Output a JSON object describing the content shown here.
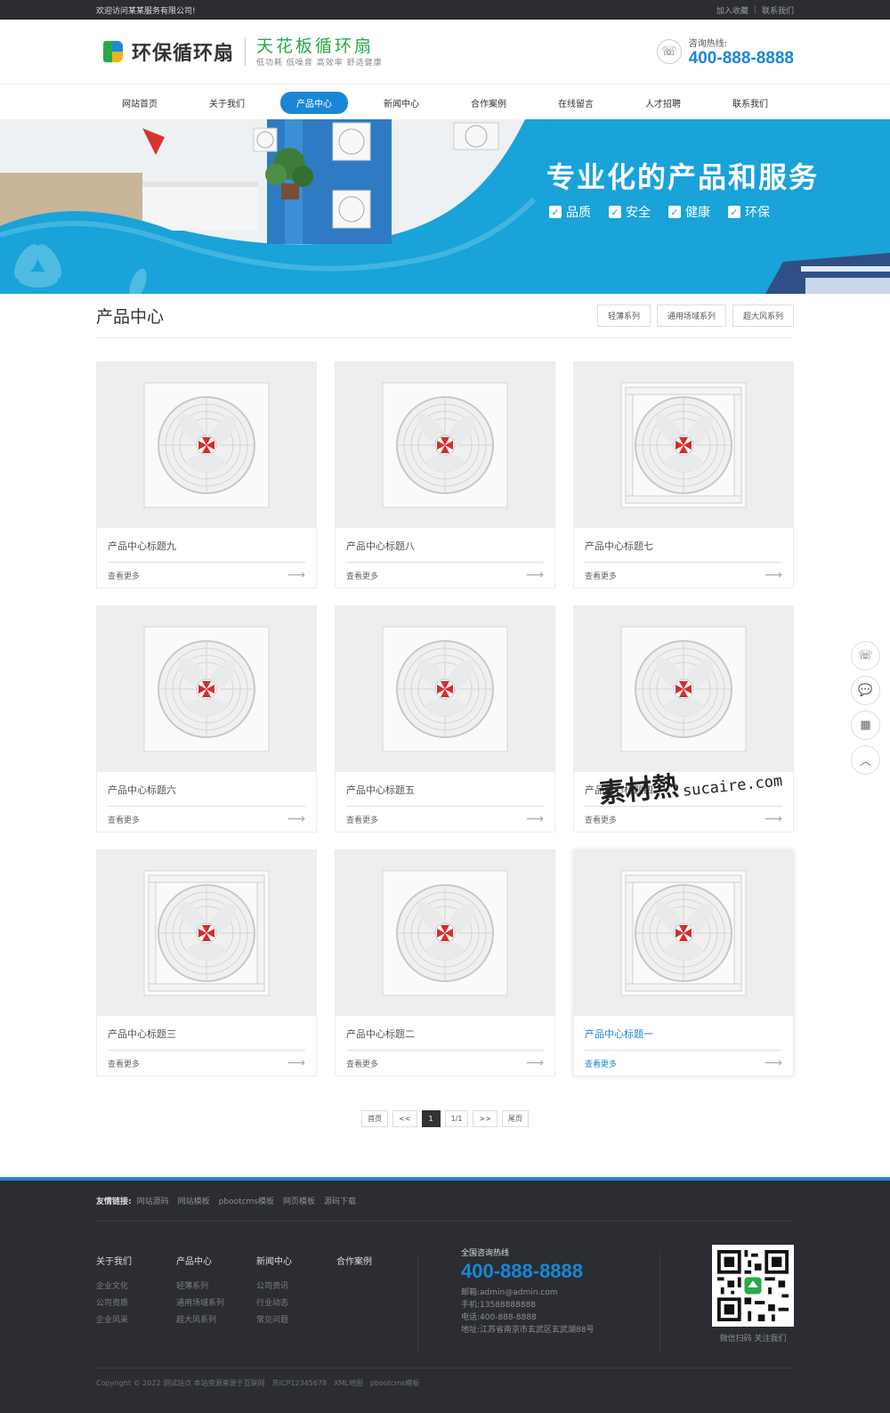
{
  "topbar": {
    "welcome": "欢迎访问某某服务有限公司!",
    "favorite": "加入收藏",
    "contact": "联系我们"
  },
  "header": {
    "logo_name": "环保循环扇",
    "slogan": "天花板循环扇",
    "slogan_sub": "低功耗 低噪音 高效率 舒适健康",
    "hotline_label": "咨询热线:",
    "hotline": "400-888-8888"
  },
  "nav": [
    {
      "label": "网站首页"
    },
    {
      "label": "关于我们"
    },
    {
      "label": "产品中心",
      "active": true
    },
    {
      "label": "新闻中心"
    },
    {
      "label": "合作案例"
    },
    {
      "label": "在线留言"
    },
    {
      "label": "人才招聘"
    },
    {
      "label": "联系我们"
    }
  ],
  "banner": {
    "title": "专业化的产品和服务",
    "tags": [
      "品质",
      "安全",
      "健康",
      "环保"
    ]
  },
  "section": {
    "title": "产品中心",
    "categories": [
      "轻薄系列",
      "通用场域系列",
      "超大风系列"
    ]
  },
  "products": [
    {
      "title": "产品中心标题九",
      "more": "查看更多"
    },
    {
      "title": "产品中心标题八",
      "more": "查看更多"
    },
    {
      "title": "产品中心标题七",
      "more": "查看更多"
    },
    {
      "title": "产品中心标题六",
      "more": "查看更多"
    },
    {
      "title": "产品中心标题五",
      "more": "查看更多"
    },
    {
      "title": "产品中心标题四",
      "more": "查看更多"
    },
    {
      "title": "产品中心标题三",
      "more": "查看更多"
    },
    {
      "title": "产品中心标题二",
      "more": "查看更多"
    },
    {
      "title": "产品中心标题一",
      "more": "查看更多"
    }
  ],
  "pager": {
    "first": "首页",
    "prev": "<<",
    "current": "1",
    "info": "1/1",
    "next": ">>",
    "last": "尾页"
  },
  "footer": {
    "friend_label": "友情链接:",
    "friend_links": [
      "网站源码",
      "网站模板",
      "pbootcms模板",
      "网页模板",
      "源码下载"
    ],
    "columns": [
      {
        "title": "关于我们",
        "items": [
          "企业文化",
          "公司资质",
          "企业风采"
        ]
      },
      {
        "title": "产品中心",
        "items": [
          "轻薄系列",
          "通用场域系列",
          "超大风系列"
        ]
      },
      {
        "title": "新闻中心",
        "items": [
          "公司资讯",
          "行业动态",
          "常见问题"
        ]
      },
      {
        "title": "合作案例",
        "items": []
      }
    ],
    "hotline_label": "全国咨询热线",
    "hotline": "400-888-8888",
    "email": "邮箱:admin@admin.com",
    "mobile": "手机:13588888888",
    "tel": "电话:400-888-8888",
    "address": "地址:江苏省南京市玄武区玄武湖88号",
    "qr_caption": "微信扫码 关注我们",
    "copyright": "Copyright © 2022 测试站点 本站资源来源于互联网",
    "icp": "苏ICP12345678",
    "xml": "XML地图",
    "pboot": "pbootcms模板"
  },
  "side_tools": [
    "phone-icon",
    "chat-icon",
    "qrcode-icon",
    "back-to-top-icon"
  ],
  "watermark": {
    "cn": "素材熱",
    "en": "sucaire.com"
  }
}
